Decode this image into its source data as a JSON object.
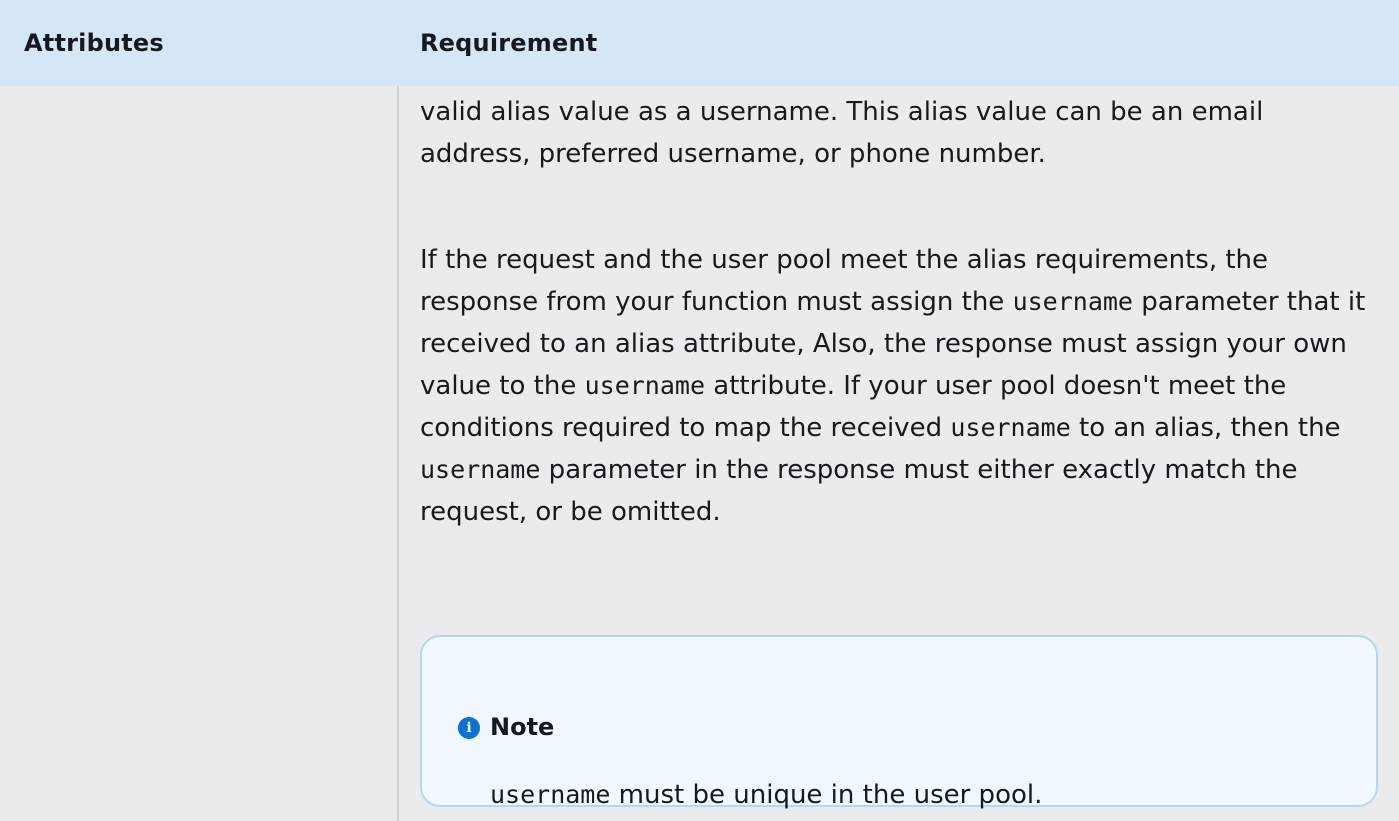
{
  "table": {
    "headers": {
      "attributes": "Attributes",
      "requirement": "Requirement"
    },
    "requirement_cell": {
      "para1": [
        {
          "text": "valid alias value as a username. This alias value can be an email address, preferred username, or phone number.",
          "code": false
        }
      ],
      "para2": [
        {
          "text": "If the request and the user pool meet the alias requirements, the response from your function must assign the ",
          "code": false
        },
        {
          "text": "username",
          "code": true
        },
        {
          "text": " parameter that it received to an alias attribute, Also, the response must assign your own value to the ",
          "code": false
        },
        {
          "text": "username",
          "code": true
        },
        {
          "text": " attribute. If your user pool doesn't meet the conditions required to map the received ",
          "code": false
        },
        {
          "text": "username",
          "code": true
        },
        {
          "text": " to an alias, then the ",
          "code": false
        },
        {
          "text": "username",
          "code": true
        },
        {
          "text": " parameter in the response must either exactly match the request, or be omitted.",
          "code": false
        }
      ],
      "note": {
        "icon": "info-icon",
        "icon_glyph": "i",
        "title": "Note",
        "body": [
          {
            "text": "username",
            "code": true
          },
          {
            "text": " must be unique in the user pool.",
            "code": false
          }
        ]
      }
    }
  },
  "colors": {
    "header_bg": "#d5e6f6",
    "page_bg": "#e9ebed",
    "note_bg": "#f1f8fe",
    "note_border": "#b9d6ee",
    "info_icon": "#0972d3",
    "text": "#16191f"
  }
}
